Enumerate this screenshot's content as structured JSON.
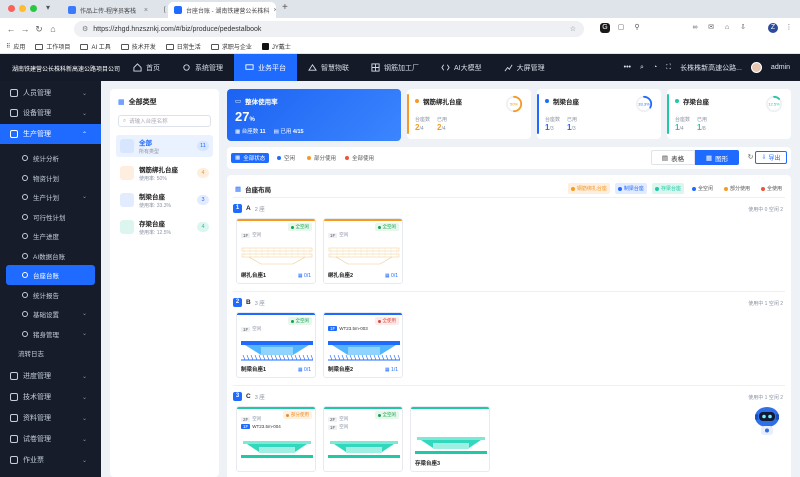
{
  "browser": {
    "tabs": [
      {
        "label": "作品上传-程序员客栈"
      },
      {
        "label": "["
      },
      {
        "label": "台座台账 - 湖南铁建营公长株科"
      }
    ],
    "url": "https://zhgd.hnzsznkj.com/#/biz/produce/pedestalbook",
    "bookmarks": [
      "应用",
      "工作项目",
      "AI 工具",
      "技术开发",
      "日常生活",
      "求职与企业",
      "JY戴士"
    ],
    "profile_initial": "Z"
  },
  "app": {
    "brand": "湖南铁建营公长株科新高速公路项目公司",
    "nav": [
      "首页",
      "系统管理",
      "业务平台",
      "智慧物联",
      "钢筋加工厂",
      "AI大模型",
      "大屏管理"
    ],
    "project": "长株株新高速公路...",
    "user": "admin",
    "more": "•••"
  },
  "sidebar": {
    "groups": [
      {
        "label": "人员管理"
      },
      {
        "label": "设备管理"
      },
      {
        "label": "生产管理"
      }
    ],
    "sub": [
      "统计分析",
      "物资计划",
      "生产计划",
      "可行性计划",
      "生产进度",
      "AI数据台账",
      "台座台账",
      "统计报告",
      "基础设置",
      "猪身管理",
      "流转日志"
    ],
    "bottom": [
      "进度管理",
      "技术管理",
      "资料管理",
      "试卷管理",
      "作业票"
    ]
  },
  "left_panel": {
    "title": "全部类型",
    "search_placeholder": "请输入台座名称",
    "items": [
      {
        "name": "全部",
        "sub": "所有类型",
        "count": "11"
      },
      {
        "name": "钢筋绑扎台座",
        "sub": "使用率: 50%",
        "count": "4"
      },
      {
        "name": "制梁台座",
        "sub": "使用率: 33.3%",
        "count": "3"
      },
      {
        "name": "存梁台座",
        "sub": "使用率: 12.5%",
        "count": "4"
      }
    ]
  },
  "cards": {
    "overall": {
      "title": "整体使用率",
      "value": "27",
      "unit": "%",
      "total_label": "台座数",
      "total": "11",
      "used_label": "已用",
      "used": "4/15"
    },
    "types": [
      {
        "title": "钢筋绑扎台座",
        "ring": "50%",
        "ring_value": 0.5,
        "l1": "台座数",
        "v1": "2",
        "d1": "/4",
        "l2": "已用",
        "v2": "2",
        "d2": "/4",
        "color": "#f59a23"
      },
      {
        "title": "制梁台座",
        "ring": "33.3%",
        "ring_value": 0.333,
        "l1": "台座数",
        "v1": "1",
        "d1": "/3",
        "l2": "已用",
        "v2": "1",
        "d2": "/3",
        "color": "#1f6bff"
      },
      {
        "title": "存梁台座",
        "ring": "12.5%",
        "ring_value": 0.125,
        "l1": "台座数",
        "v1": "1",
        "d1": "/4",
        "l2": "已用",
        "v2": "1",
        "d2": "/8",
        "color": "#20c9a5"
      }
    ]
  },
  "filters": {
    "tags": [
      "全部状态",
      "空闲",
      "部分使用",
      "全部使用"
    ],
    "view_table": "表格",
    "view_graph": "图形",
    "export": "导出"
  },
  "layout": {
    "title": "台座布局",
    "legend": [
      "钢筋绑扎台座",
      "制梁台座",
      "存梁台座",
      "全空闲",
      "部分使用",
      "全使用"
    ],
    "sections": [
      {
        "num": "1",
        "name": "A",
        "count": "2 座",
        "stat": "使用中 0   空闲 2",
        "slots": [
          {
            "status": "全空闲",
            "p1": "1F",
            "p1t": "空闲",
            "name": "绑扎台座1",
            "frac": "0/1",
            "type": "bind"
          },
          {
            "status": "全空闲",
            "p1": "1F",
            "p1t": "空闲",
            "name": "绑扎台座2",
            "frac": "0/1",
            "type": "bind"
          }
        ]
      },
      {
        "num": "2",
        "name": "B",
        "count": "3 座",
        "stat": "使用中 1   空闲 2",
        "slots": [
          {
            "status": "全空闲",
            "p1": "1F",
            "p1t": "空闲",
            "name": "制梁台座1",
            "frac": "0/1",
            "type": "make"
          },
          {
            "status": "全使用",
            "p1": "1F",
            "p1t": "WT23.5m-003",
            "name": "制梁台座2",
            "frac": "1/1",
            "type": "make"
          }
        ]
      },
      {
        "num": "3",
        "name": "C",
        "count": "3 座",
        "stat": "使用中 1   空闲 2",
        "slots": [
          {
            "status": "部分使用",
            "p1": "2F",
            "p1t": "空闲",
            "p2": "1F",
            "p2t": "WT23.5m-004",
            "name": "",
            "frac": "",
            "type": "store"
          },
          {
            "status": "全空闲",
            "p1": "2F",
            "p1t": "空闲",
            "p2": "1F",
            "p2t": "空闲",
            "name": "",
            "frac": "",
            "type": "store"
          },
          {
            "status": "",
            "p1": "",
            "p1t": "",
            "name": "存梁台座3",
            "frac": "",
            "type": "store"
          }
        ]
      }
    ]
  },
  "colors": {
    "accent": "#1f6bff",
    "orange": "#f59a23",
    "teal": "#20c9a5",
    "red": "#f0533a",
    "sidebar": "#161c29"
  }
}
